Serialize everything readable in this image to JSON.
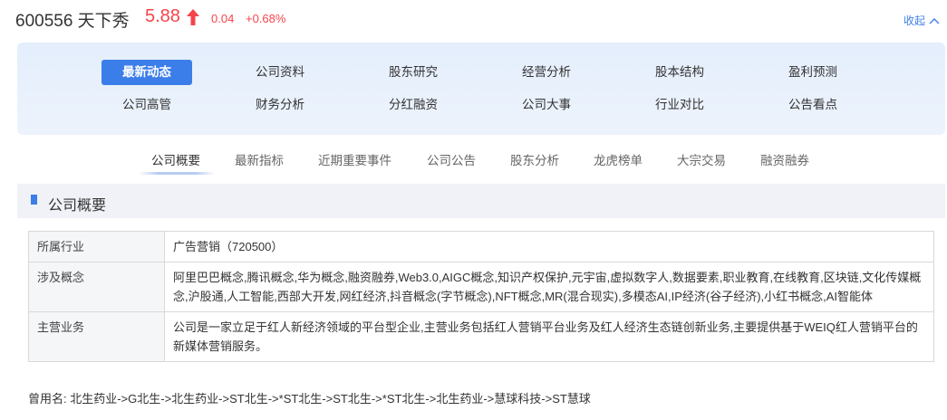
{
  "stock": {
    "code_name": "600556 天下秀",
    "price": "5.88",
    "change": "0.04",
    "change_pct": "+0.68%",
    "up_color": "#f5444b"
  },
  "collapse_label": "收起",
  "nav": {
    "items": [
      "最新动态",
      "公司资料",
      "股东研究",
      "经营分析",
      "股本结构",
      "盈利预测",
      "公司高管",
      "财务分析",
      "分红融资",
      "公司大事",
      "行业对比",
      "公告看点"
    ],
    "active_index": 0,
    "accent_color": "#3b7ee9"
  },
  "subtabs": {
    "items": [
      "公司概要",
      "最新指标",
      "近期重要事件",
      "公司公告",
      "股东分析",
      "龙虎榜单",
      "大宗交易",
      "融资融券"
    ],
    "active_index": 0
  },
  "section": {
    "title": "公司概要",
    "rows": [
      {
        "label": "所属行业",
        "value": "广告营销（720500）"
      },
      {
        "label": "涉及概念",
        "value": "阿里巴巴概念,腾讯概念,华为概念,融资融券,Web3.0,AIGC概念,知识产权保护,元宇宙,虚拟数字人,数据要素,职业教育,在线教育,区块链,文化传媒概念,沪股通,人工智能,西部大开发,网红经济,抖音概念(字节概念),NFT概念,MR(混合现实),多模态AI,IP经济(谷子经济),小红书概念,AI智能体"
      },
      {
        "label": "主营业务",
        "value": "公司是一家立足于红人新经济领域的平台型企业,主营业务包括红人营销平台业务及红人经济生态链创新业务,主要提供基于WEIQ红人营销平台的新媒体营销服务。"
      }
    ],
    "former_names": "曾用名: 北生药业->G北生->北生药业->ST北生->*ST北生->ST北生->*ST北生->北生药业->慧球科技->ST慧球"
  }
}
